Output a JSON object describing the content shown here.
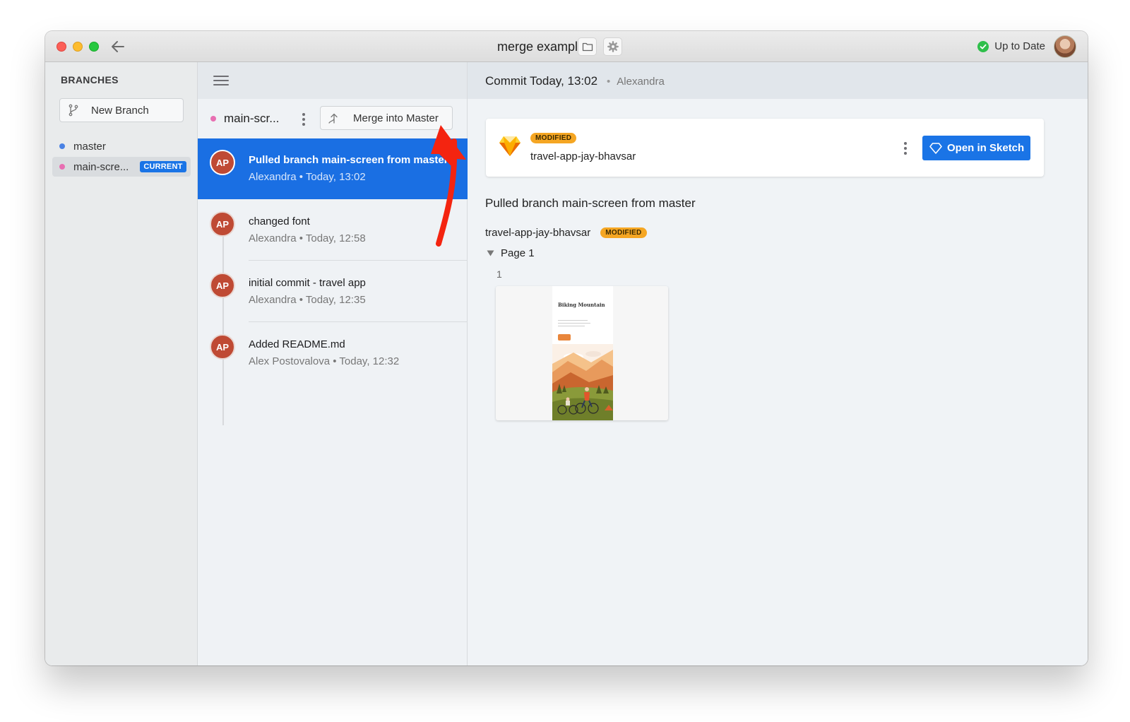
{
  "window": {
    "title": "merge example",
    "status_text": "Up to Date"
  },
  "icons": {
    "back": "arrow-left-icon",
    "folder": "folder-icon",
    "gear": "gear-icon",
    "status": "check-circle-icon",
    "branch": "git-branch-icon",
    "merge": "merge-icon",
    "menu": "hamburger-menu-icon",
    "sketch": "sketch-diamond-icon",
    "disclosure": "triangle-down-icon"
  },
  "sidebar": {
    "title": "BRANCHES",
    "new_branch_label": "New Branch",
    "branches": [
      {
        "name": "master",
        "color": "#4a82e4"
      },
      {
        "name": "main-scre...",
        "color": "#e86fb2",
        "badge": "CURRENT"
      }
    ]
  },
  "history": {
    "branch_name": "main-scr...",
    "merge_label": "Merge into Master",
    "commits": [
      {
        "initials": "AP",
        "message": "Pulled branch main-screen from master",
        "author": "Alexandra",
        "time": "Today, 13:02"
      },
      {
        "initials": "AP",
        "message": "changed font",
        "author": "Alexandra",
        "time": "Today, 12:58"
      },
      {
        "initials": "AP",
        "message": "initial commit - travel app",
        "author": "Alexandra",
        "time": "Today, 12:35"
      },
      {
        "initials": "AP",
        "message": "Added README.md",
        "author": "Alex Postovalova",
        "time": "Today, 12:32"
      }
    ]
  },
  "detail": {
    "title": "Commit Today, 13:02",
    "author": "Alexandra",
    "file": {
      "badge": "MODIFIED",
      "name": "travel-app-jay-bhavsar",
      "open_label": "Open in Sketch"
    },
    "commit_message": "Pulled branch main-screen from master",
    "changes": {
      "file_name": "travel-app-jay-bhavsar",
      "badge": "MODIFIED",
      "page_label": "Page 1",
      "artboard_number": "1",
      "artboard_title": "Biking Mountain"
    }
  },
  "colors": {
    "accent": "#1a74e6",
    "selected_row": "#1a6fe3",
    "modified_badge": "#f5a623",
    "avatar": "#bf4a34",
    "status_ok": "#2fbf4b",
    "annotation_arrow": "#f42410"
  }
}
